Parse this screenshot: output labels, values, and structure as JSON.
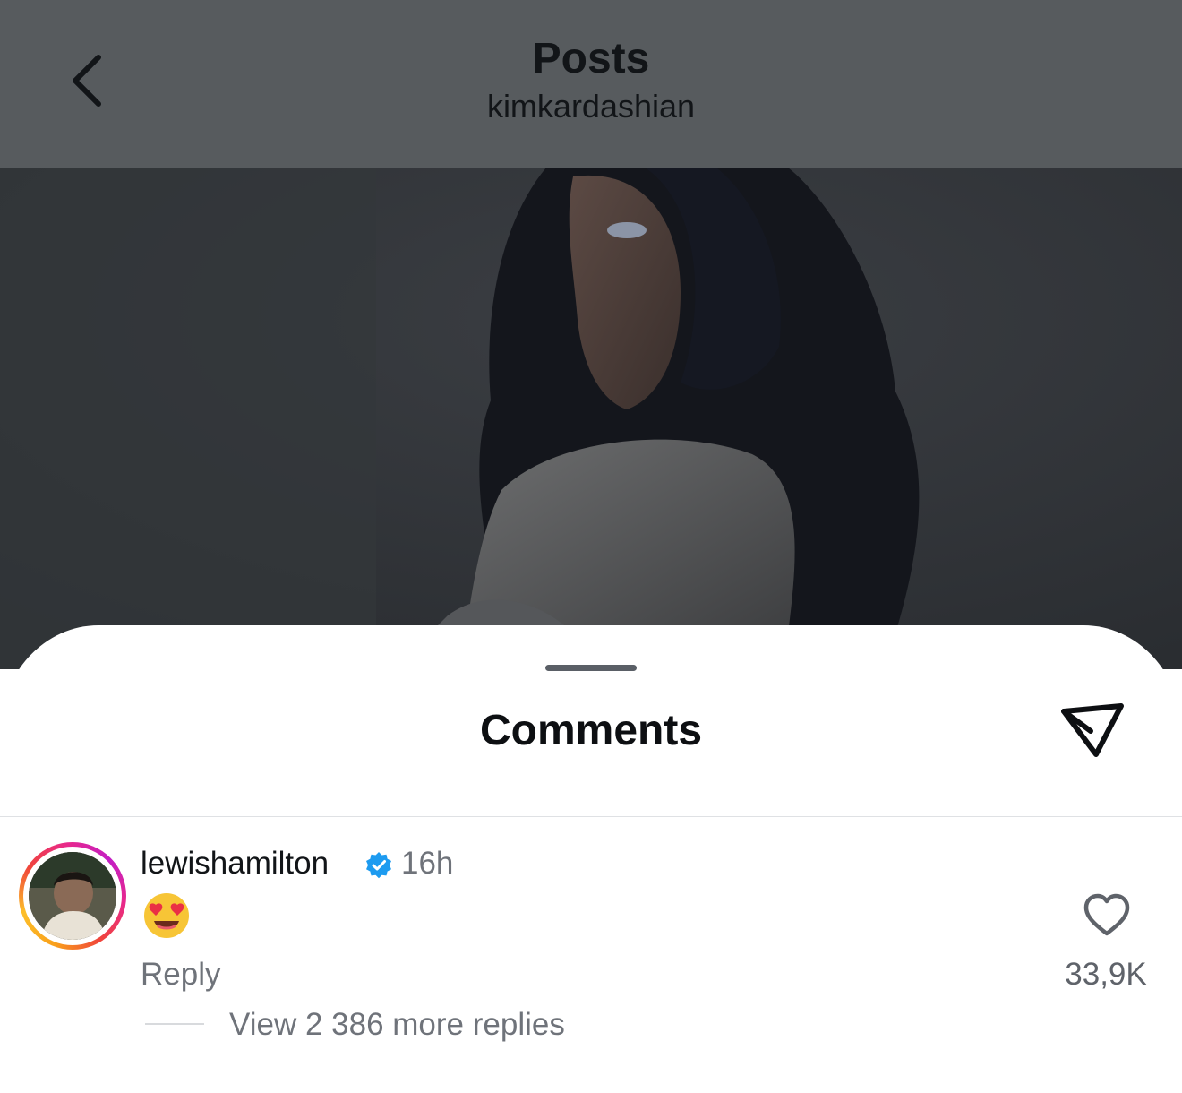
{
  "header": {
    "title": "Posts",
    "subtitle": "kimkardashian",
    "back_icon": "chevron-left-icon"
  },
  "post": {
    "image_description_icon": "post-photo"
  },
  "comments_sheet": {
    "title": "Comments",
    "share_icon": "send-icon"
  },
  "comment": {
    "username": "lewishamilton",
    "verified": true,
    "timestamp": "16h",
    "text": "😍",
    "reply_label": "Reply",
    "like_count": "33,9K",
    "view_replies_label": "View 2 386 more replies"
  },
  "colors": {
    "header_bg": "#575b5e",
    "verified_blue": "#1d9bf0",
    "muted_text": "#6f737a"
  }
}
